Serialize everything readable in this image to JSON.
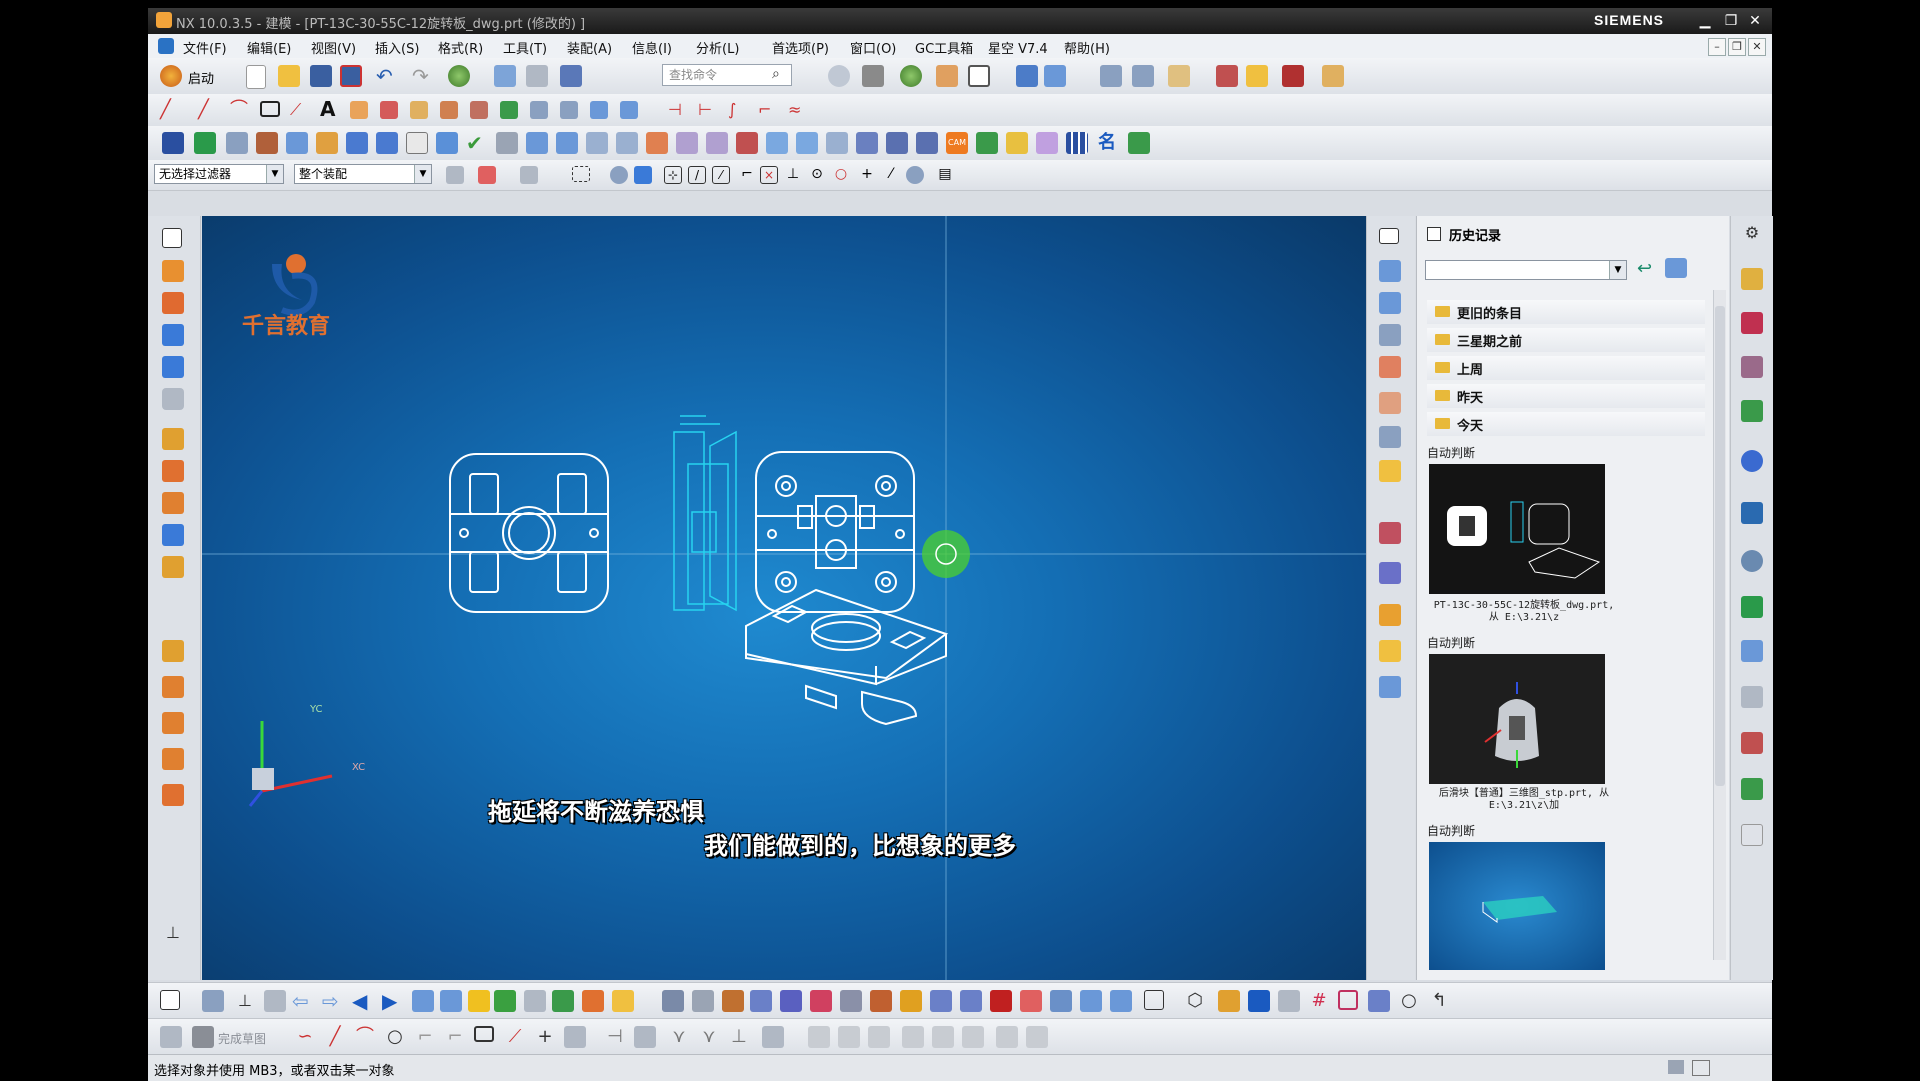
{
  "window": {
    "title": "NX 10.0.3.5 - 建模 - [PT-13C-30-55C-12旋转板_dwg.prt  (修改的) ]",
    "brand": "SIEMENS"
  },
  "menu": [
    "文件(F)",
    "编辑(E)",
    "视图(V)",
    "插入(S)",
    "格式(R)",
    "工具(T)",
    "装配(A)",
    "信息(I)",
    "分析(L)",
    "首选项(P)",
    "窗口(O)",
    "GC工具箱",
    "星空 V7.4",
    "帮助(H)"
  ],
  "toolbar": {
    "start_label": "启动",
    "search_placeholder": "查找命令",
    "filter_value": "无选择过滤器",
    "scope_value": "整个装配"
  },
  "viewport": {
    "watermark_text": "千言教育",
    "axis_labels": [
      "YC",
      "XC"
    ],
    "subtitle_1": "拖延将不断滋养恐惧",
    "subtitle_2": "我们能做到的，比想象的更多"
  },
  "history": {
    "title": "历史记录",
    "groups": [
      "更旧的条目",
      "三星期之前",
      "上周",
      "昨天",
      "今天"
    ],
    "entries": [
      {
        "heading": "自动判断",
        "caption": "PT-13C-30-55C-12旋转板_dwg.prt, 从 E:\\3.21\\z"
      },
      {
        "heading": "自动判断",
        "caption": "后滑块【普通】三维图_stp.prt, 从 E:\\3.21\\z\\加"
      },
      {
        "heading": "自动判断",
        "caption": ""
      }
    ]
  },
  "status": {
    "prompt": "选择对象并使用 MB3，或者双击某一对象",
    "bottom_label": "完成草图"
  },
  "colors": {
    "viewport_bg": "#146eb4",
    "drawing_line": "#ffffff",
    "section_line": "#27d3f0",
    "cursor_highlight": "#4cd22c"
  }
}
